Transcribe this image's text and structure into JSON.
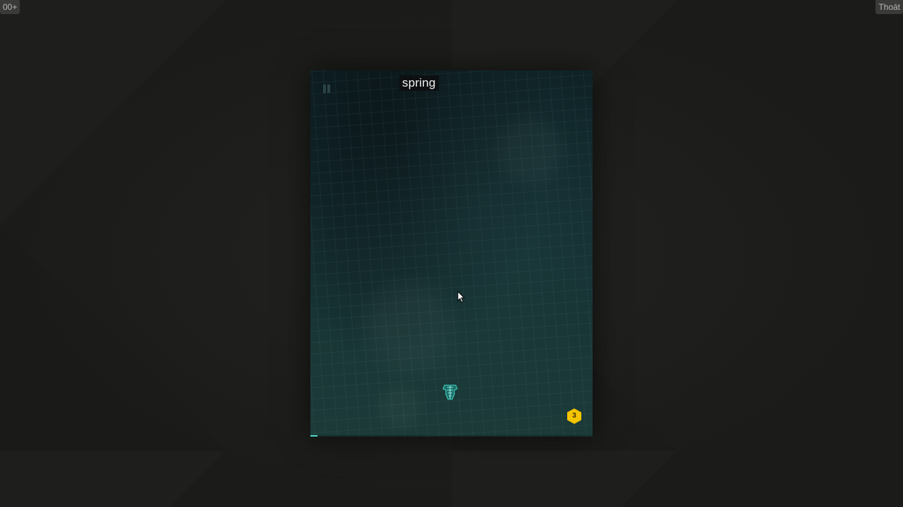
{
  "corner": {
    "left_label": "00+",
    "right_label": "Thoát"
  },
  "game": {
    "current_word": "spring",
    "coin_count": "3",
    "progress": 0.025,
    "colors": {
      "accent": "#4fd6c8",
      "coin": "#f5c400",
      "ship": "#3fd9c5"
    },
    "icons": {
      "pause": "pause-icon",
      "ship": "spaceship-icon",
      "coin": "hexagon-coin-icon"
    }
  }
}
